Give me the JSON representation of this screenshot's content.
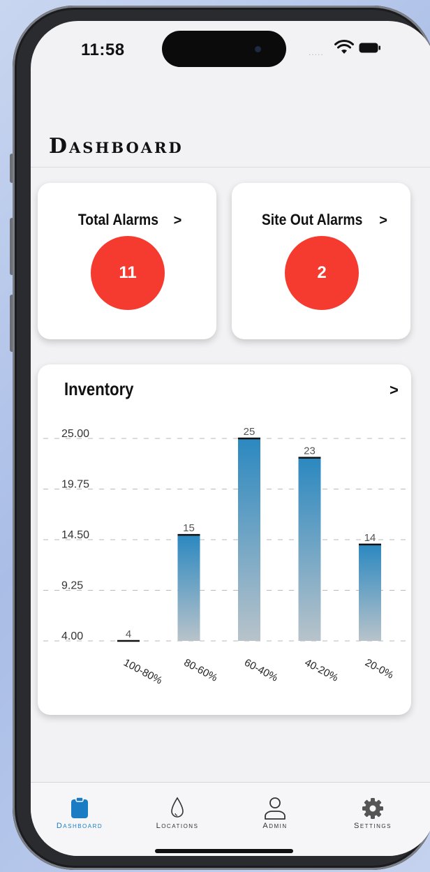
{
  "status_bar": {
    "time": "11:58",
    "signal": "....."
  },
  "header": {
    "title": "Dashboard"
  },
  "alarm_cards": [
    {
      "label": "Total Alarms",
      "chevron": ">",
      "count": "11"
    },
    {
      "label": "Site Out Alarms",
      "chevron": ">",
      "count": "2"
    }
  ],
  "inventory": {
    "title": "Inventory",
    "chevron": ">"
  },
  "chart_data": {
    "type": "bar",
    "title": "Inventory",
    "categories": [
      "100-80%",
      "80-60%",
      "60-40%",
      "40-20%",
      "20-0%"
    ],
    "values": [
      4,
      15,
      25,
      23,
      14
    ],
    "y_ticks": [
      "25.00",
      "19.75",
      "14.50",
      "9.25",
      "4.00"
    ],
    "ylim": [
      4,
      25
    ],
    "grid": true
  },
  "tabs": [
    {
      "label": "Dashboard",
      "icon": "clipboard-icon",
      "active": true
    },
    {
      "label": "Locations",
      "icon": "drop-icon",
      "active": false
    },
    {
      "label": "Admin",
      "icon": "person-icon",
      "active": false
    },
    {
      "label": "Settings",
      "icon": "gear-icon",
      "active": false
    }
  ],
  "colors": {
    "accent": "#1a7dc4",
    "alarm": "#f53b30",
    "bar_top": "#2b88c0",
    "bar_bottom": "#b8c3ca"
  }
}
